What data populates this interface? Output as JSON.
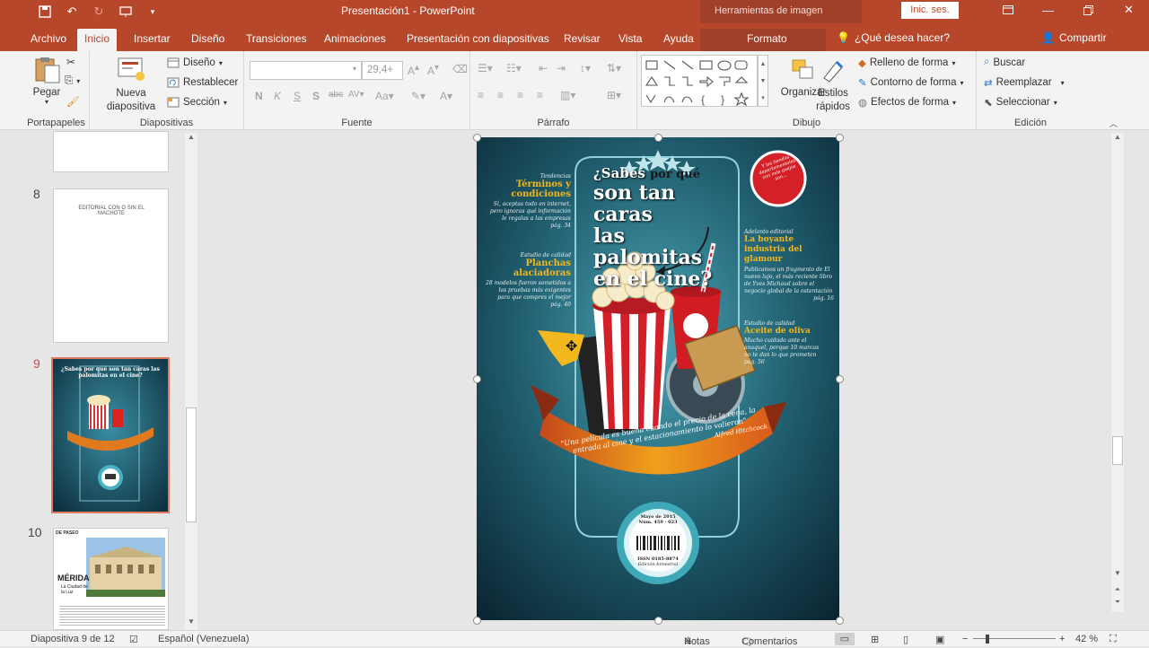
{
  "titlebar": {
    "title": "Presentación1  -  PowerPoint",
    "context_title": "Herramientas de imagen",
    "signin": "Inic. ses."
  },
  "tabs": [
    "Archivo",
    "Inicio",
    "Insertar",
    "Diseño",
    "Transiciones",
    "Animaciones",
    "Presentación con diapositivas",
    "Revisar",
    "Vista",
    "Ayuda",
    "Formato"
  ],
  "tellme": "¿Qué desea hacer?",
  "share": "Compartir",
  "ribbon": {
    "clipboard": {
      "paste": "Pegar",
      "label": "Portapapeles"
    },
    "slides": {
      "new_slide": "Nueva diapositiva",
      "layout": "Diseño",
      "reset": "Restablecer",
      "section": "Sección",
      "label": "Diapositivas"
    },
    "font": {
      "size": "29,4+",
      "label": "Fuente"
    },
    "paragraph": {
      "label": "Párrafo"
    },
    "drawing": {
      "arrange": "Organizar",
      "quick_styles": "Estilos rápidos",
      "fill": "Relleno de forma",
      "outline": "Contorno de forma",
      "effects": "Efectos de forma",
      "label": "Dibujo"
    },
    "editing": {
      "find": "Buscar",
      "replace": "Reemplazar",
      "select": "Seleccionar",
      "label": "Edición"
    }
  },
  "thumbs": {
    "slide8": {
      "num": "8",
      "text": "EDITORIAL CON O SIN EL MACHOTE"
    },
    "slide9": {
      "num": "9",
      "text": "¿Sabes por qué son tan caras las palomitas en el cine?"
    },
    "slide10": {
      "num": "10",
      "title": "MÉRIDA",
      "subtitle": "La Ciudad de la Luz",
      "tag": "DE PASEO"
    }
  },
  "cover": {
    "headline_1": "¿Sabes",
    "headline_2": "por qué",
    "headline_3": "son tan caras",
    "headline_4": "las palomitas",
    "headline_5": "en el cine?",
    "left1_tag": "Tendencias",
    "left1_title": "Términos y condiciones",
    "left1_body": "Sí, aceptas todo en internet, pero ignoras qué información le regalas a las empresas",
    "left1_page": "pág. 34",
    "left2_tag": "Estudio de calidad",
    "left2_title": "Planchas alaciadoras",
    "left2_body": "28 modelos fueron sometidos a las pruebas más exigentes para que compres el mejor",
    "left2_page": "pág. 40",
    "right1_tag": "Adelanto editorial",
    "right1_title": "La boyante industria del glamour",
    "right1_body": "Publicamos un fragmento de El nuevo lujo, el más reciente libro de Yves Michaud sobre el negocio global de la ostentación",
    "right1_page": "pág. 16",
    "right2_tag": "Estudio de calidad",
    "right2_title": "Aceite de oliva",
    "right2_body": "Mucho cuidado ante el anaquel, porque 10 marcas no te dan lo que prometen",
    "right2_page": "pág. 56",
    "badge": "Y las tiendas departamentales con más quejas son...",
    "quote": "\"Una película es buena cuando el precio de la cena, la entrada al cine y el estacionamiento lo valieron\"",
    "quote_author": "Alfred Hitchcock",
    "issue_date": "Mayo de 2015",
    "issue_num": "Núm. 459 · 023",
    "issn": "ISSN 0185-8874",
    "issn_sub": "Edición bimestral"
  },
  "status": {
    "slide": "Diapositiva 9 de 12",
    "language": "Español (Venezuela)",
    "notes": "Notas",
    "comments": "Comentarios",
    "zoom": "42 %"
  },
  "colors": {
    "accent": "#b7472a",
    "poster_bg": "#1e5a6a",
    "poster_yellow": "#f2b81d"
  }
}
